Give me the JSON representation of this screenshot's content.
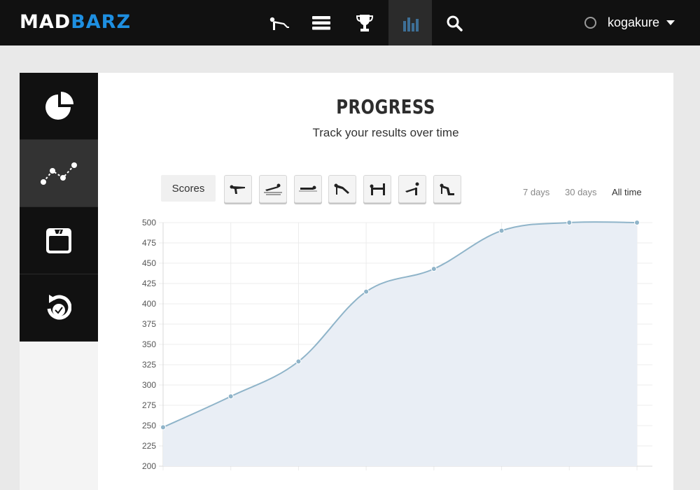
{
  "brand": {
    "logo_part1": "MAD",
    "logo_part2": "BARZ",
    "accent_color": "#1e8fe1"
  },
  "topnav": {
    "items": [
      {
        "icon": "pushup-icon"
      },
      {
        "icon": "list-icon"
      },
      {
        "icon": "trophy-icon"
      },
      {
        "icon": "bar-chart-icon",
        "active": true
      },
      {
        "icon": "search-icon"
      }
    ],
    "user": {
      "name": "kogakure"
    }
  },
  "sidebar": {
    "items": [
      {
        "icon": "pie-chart-icon"
      },
      {
        "icon": "line-graph-icon",
        "active": true
      },
      {
        "icon": "scale-icon"
      },
      {
        "icon": "history-icon"
      }
    ]
  },
  "page": {
    "title": "PROGRESS",
    "subtitle": "Track your results over time",
    "scores_label": "Scores",
    "exercises": [
      {
        "icon": "exercise-1-icon"
      },
      {
        "icon": "exercise-2-icon"
      },
      {
        "icon": "exercise-3-icon"
      },
      {
        "icon": "exercise-4-icon"
      },
      {
        "icon": "exercise-5-icon"
      },
      {
        "icon": "exercise-6-icon"
      },
      {
        "icon": "exercise-7-icon"
      }
    ],
    "ranges": [
      {
        "label": "7 days"
      },
      {
        "label": "30 days"
      },
      {
        "label": "All time",
        "selected": true
      }
    ]
  },
  "chart_data": {
    "type": "area",
    "values": [
      248,
      286,
      329,
      415,
      443,
      490,
      500,
      500
    ],
    "ylim": [
      200,
      500
    ],
    "yticks": [
      200,
      225,
      250,
      275,
      300,
      325,
      350,
      375,
      400,
      425,
      450,
      475,
      500
    ],
    "grid": true,
    "line_color": "#8fb4c9",
    "fill_color": "#e9eef5"
  }
}
